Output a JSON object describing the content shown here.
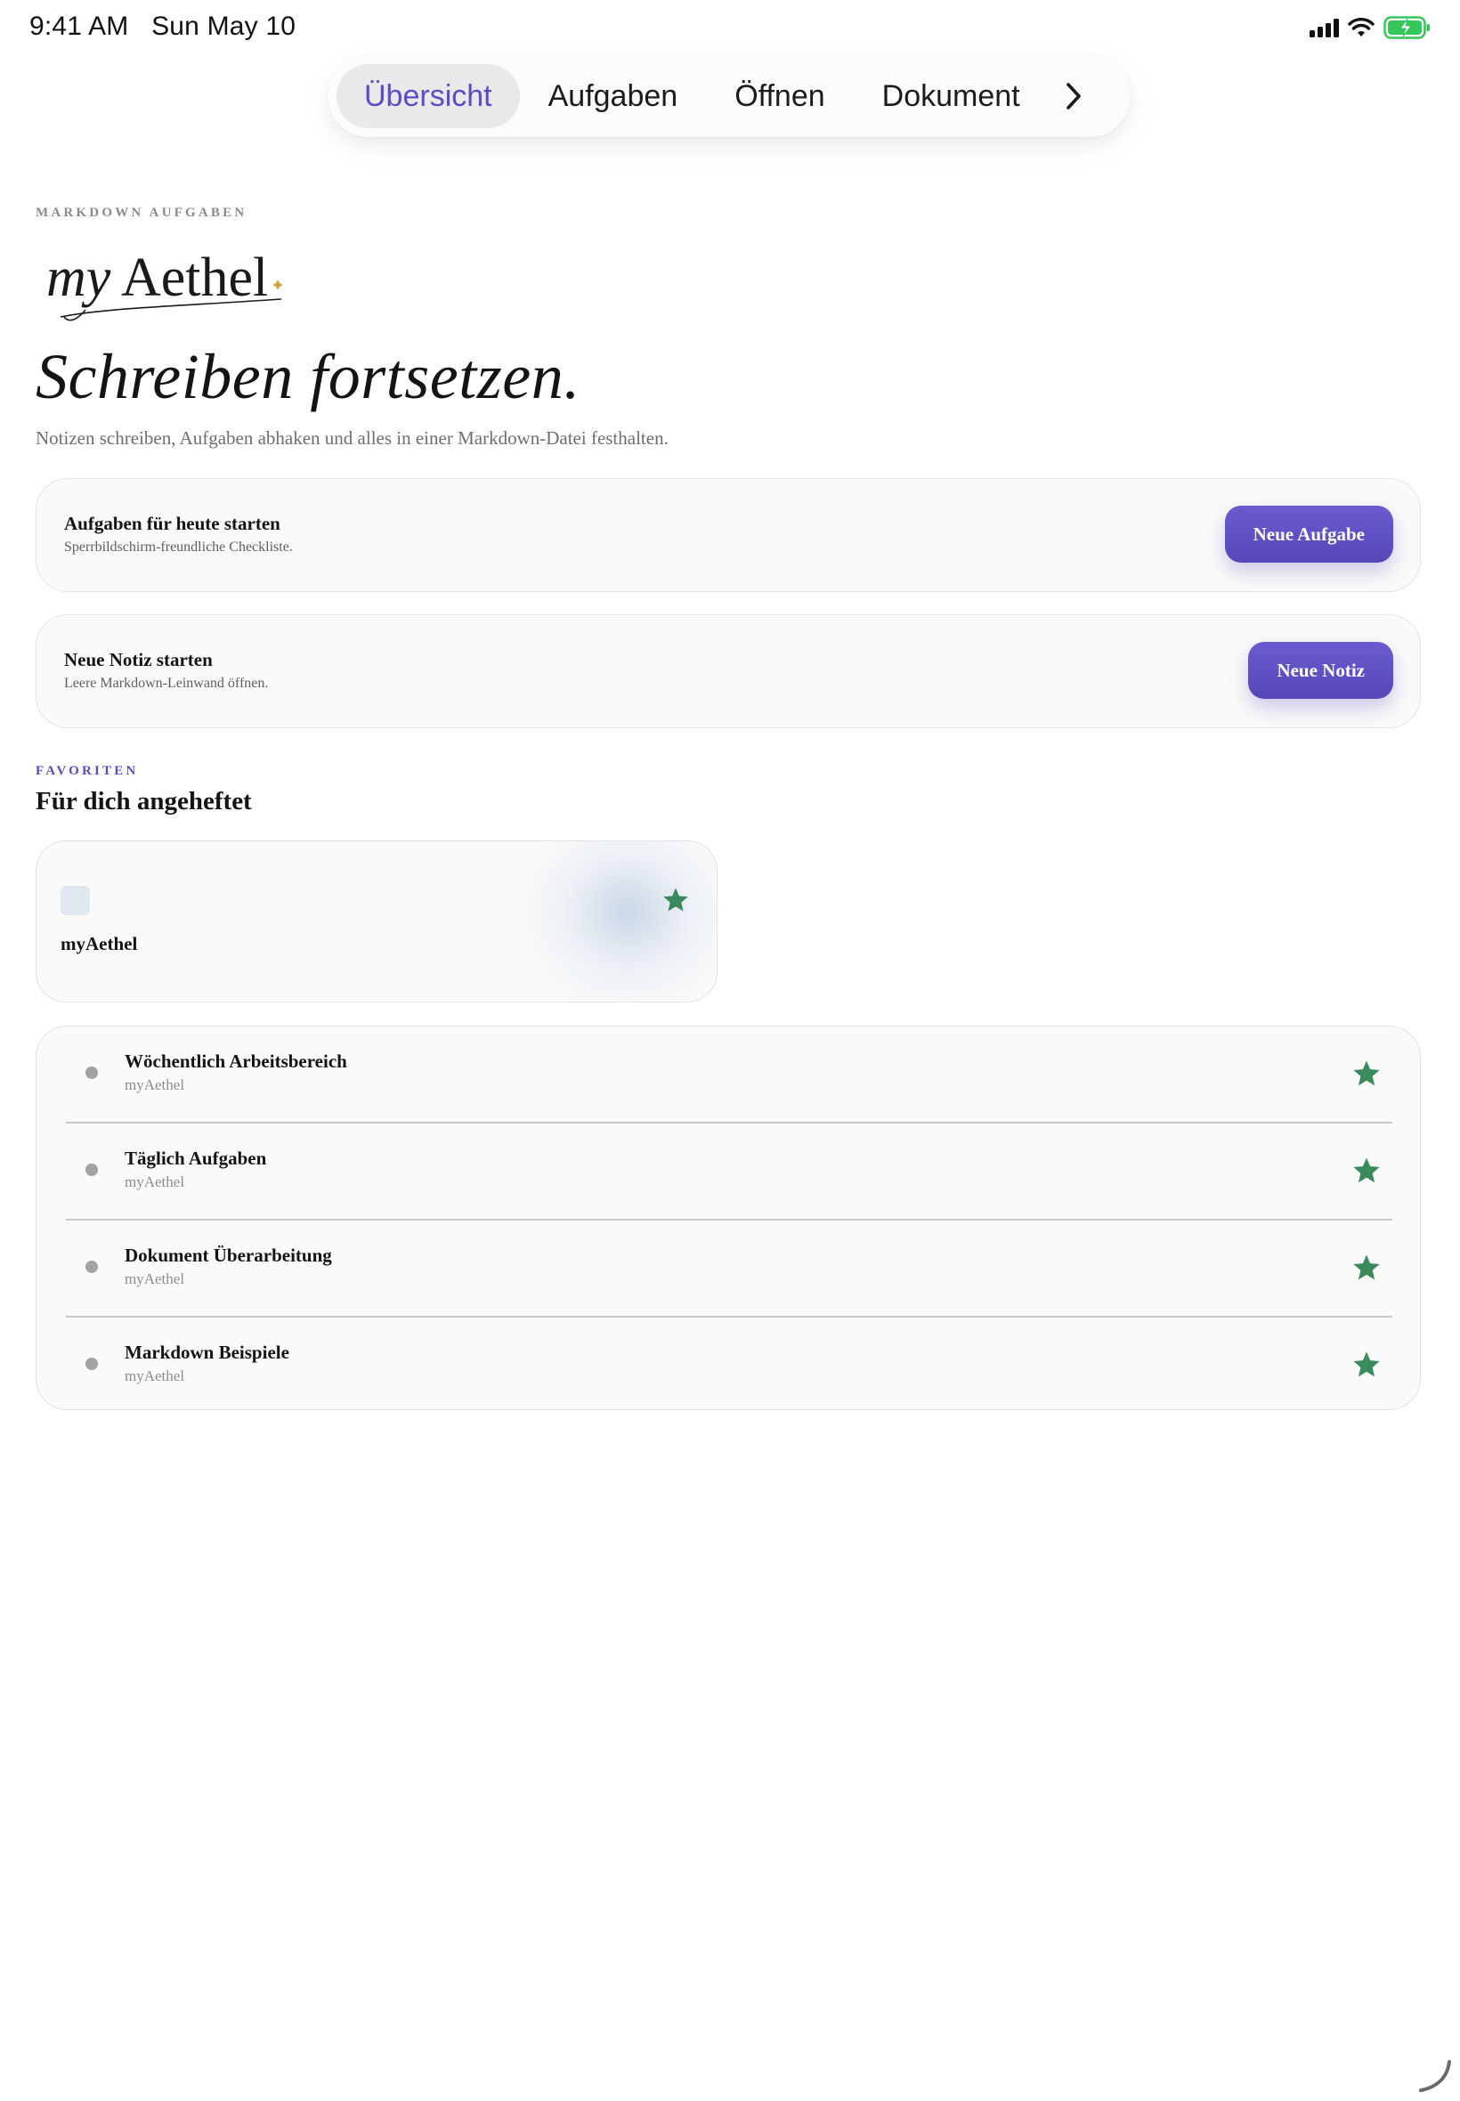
{
  "status_bar": {
    "time_date": "9:41 AM   Sun May 10"
  },
  "tabs": {
    "items": [
      {
        "label": "Übersicht",
        "active": true
      },
      {
        "label": "Aufgaben",
        "active": false
      },
      {
        "label": "Öffnen",
        "active": false
      },
      {
        "label": "Dokument",
        "active": false
      }
    ],
    "more_icon": "chevron-right-icon"
  },
  "header": {
    "eyebrow": "MARKDOWN AUFGABEN",
    "logo_text": "myAethel",
    "title": "Schreiben fortsetzen.",
    "subtitle": "Notizen schreiben, Aufgaben abhaken und alles in einer Markdown-Datei festhalten."
  },
  "actions": [
    {
      "title": "Aufgaben für heute starten",
      "description": "Sperrbildschirm-freundliche Checkliste.",
      "button_label": "Neue Aufgabe"
    },
    {
      "title": "Neue Notiz starten",
      "description": "Leere Markdown-Leinwand öffnen.",
      "button_label": "Neue Notiz"
    }
  ],
  "favorites": {
    "eyebrow": "FAVORITEN",
    "title": "Für dich angeheftet",
    "pinned": {
      "name": "myAethel",
      "icon": "star-icon"
    },
    "items": [
      {
        "title": "Wöchentlich Arbeitsbereich",
        "subtitle": "myAethel"
      },
      {
        "title": "Täglich Aufgaben",
        "subtitle": "myAethel"
      },
      {
        "title": "Dokument Überarbeitung",
        "subtitle": "myAethel"
      },
      {
        "title": "Markdown Beispiele",
        "subtitle": "myAethel"
      }
    ]
  },
  "colors": {
    "accent": "#5b4cc4",
    "button": "#5a4bbd",
    "star": "#3a8a5c",
    "battery": "#34c759",
    "logo_spark": "#d4a341"
  }
}
